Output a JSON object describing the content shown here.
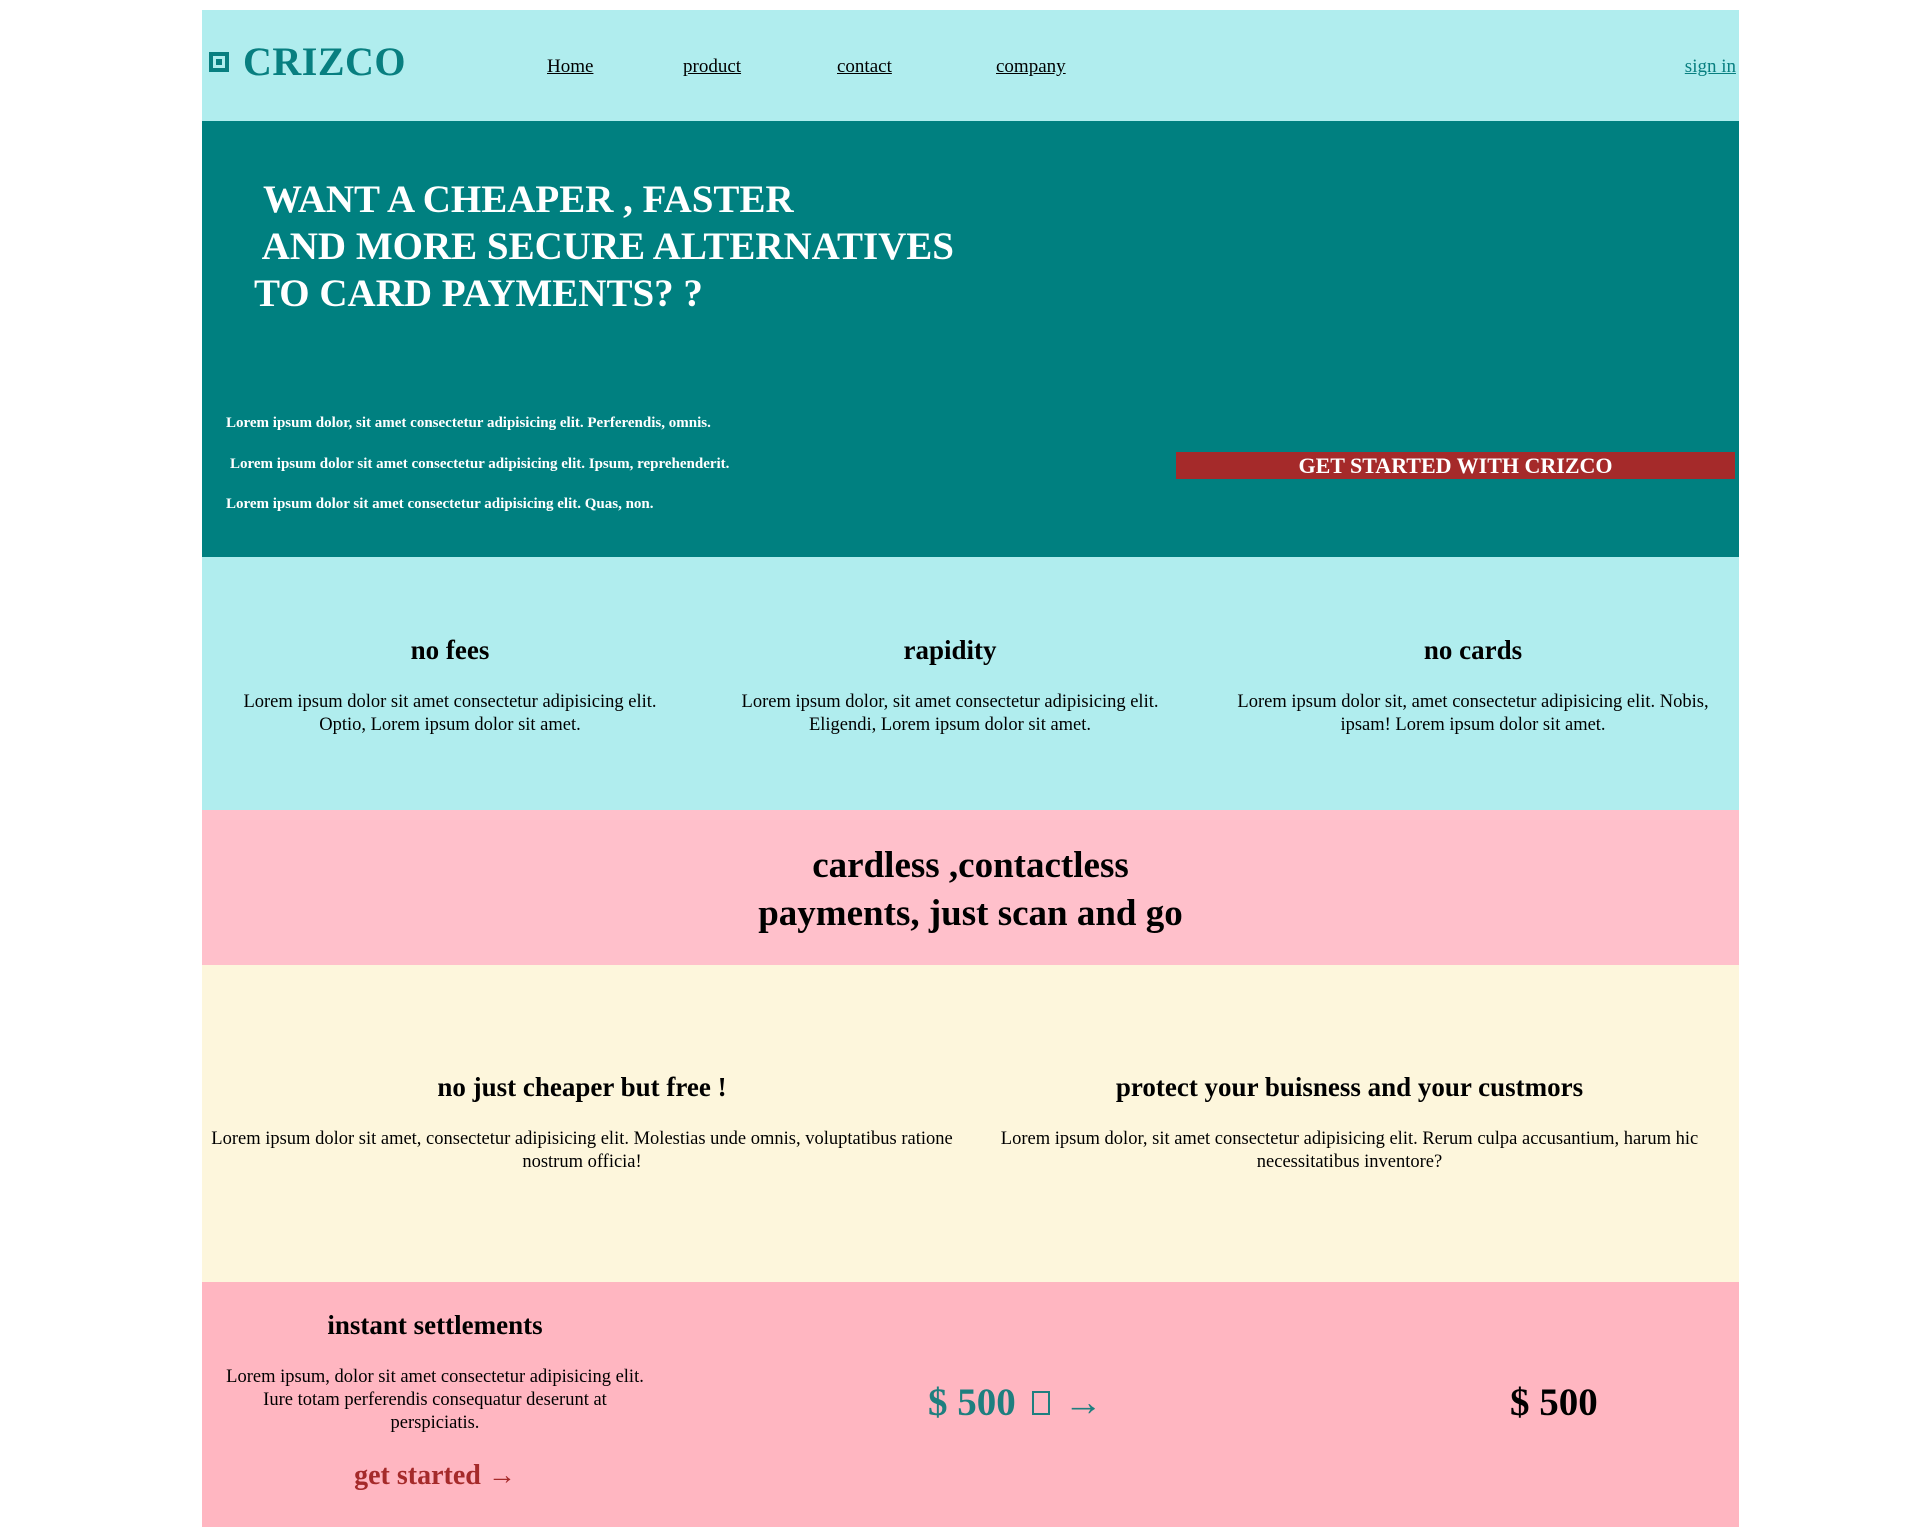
{
  "header": {
    "brand": "CRIZCO",
    "nav": [
      "Home",
      "product",
      "contact",
      "company"
    ],
    "sign_in": "sign in"
  },
  "hero": {
    "title": " WANT A CHEAPER , FASTER\n AND MORE SECURE ALTERNATIVES\nTO CARD PAYMENTS? ?",
    "lines": [
      "Lorem ipsum dolor, sit amet consectetur adipisicing elit. Perferendis, omnis.",
      "Lorem ipsum dolor sit amet consectetur adipisicing elit. Ipsum, reprehenderit.",
      "Lorem ipsum dolor sit amet consectetur adipisicing elit. Quas, non."
    ],
    "cta": "GET STARTED WITH CRIZCO"
  },
  "features": [
    {
      "title": "no fees",
      "text": "Lorem ipsum dolor sit amet consectetur adipisicing elit. Optio, Lorem ipsum dolor sit amet."
    },
    {
      "title": "rapidity",
      "text": "Lorem ipsum dolor, sit amet consectetur adipisicing elit. Eligendi, Lorem ipsum dolor sit amet."
    },
    {
      "title": "no cards",
      "text": "Lorem ipsum dolor sit, amet consectetur adipisicing elit. Nobis, ipsam! Lorem ipsum dolor sit amet."
    }
  ],
  "banner": {
    "text": "cardless ,contactless\npayments, just scan and go"
  },
  "benefits": [
    {
      "title": "no just cheaper but free !",
      "text": "Lorem ipsum dolor sit amet, consectetur adipisicing elit. Molestias unde omnis, voluptatibus ratione nostrum officia!"
    },
    {
      "title": "protect your buisness and your custmors",
      "text": "Lorem ipsum dolor, sit amet consectetur adipisicing elit. Rerum culpa accusantium, harum hic necessitatibus inventore?"
    }
  ],
  "settlements": {
    "title": "instant settlements",
    "text": "Lorem ipsum, dolor sit amet consectetur adipisicing elit. Iure totam perferendis consequatur deserunt at perspiciatis.",
    "link": "get started →",
    "amount_from": "$ 500",
    "arrow": "→",
    "amount_to": "$ 500"
  },
  "colors": {
    "header_bg": "#b0edee",
    "hero_bg": "#008080",
    "cta_bg": "#a52a2a",
    "banner_bg": "#ffc0cb",
    "cream_bg": "#fdf6dc",
    "settle_bg": "#ffb6c1"
  }
}
